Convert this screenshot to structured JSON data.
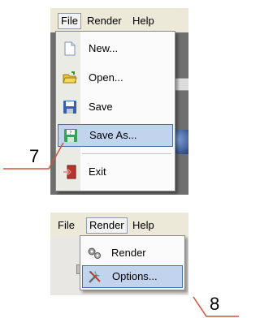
{
  "colors": {
    "callout": "#d0533a",
    "highlight_fill": "#c2d3ee",
    "highlight_border": "#4a6ea8"
  },
  "screenshot1": {
    "menubar": {
      "file": "File",
      "render": "Render",
      "help": "Help"
    },
    "file_menu": [
      {
        "label": "New...",
        "icon": "new-document-icon"
      },
      {
        "label": "Open...",
        "icon": "open-folder-icon"
      },
      {
        "label": "Save",
        "icon": "save-disk-icon"
      },
      {
        "label": "Save As...",
        "icon": "save-as-icon",
        "highlighted": true
      },
      {
        "label": "Exit",
        "icon": "exit-door-icon"
      }
    ],
    "background_tab": "e",
    "callout_number": "7"
  },
  "screenshot2": {
    "menubar": {
      "file": "File",
      "render": "Render",
      "help": "Help"
    },
    "render_menu": [
      {
        "label": "Render",
        "icon": "gears-icon"
      },
      {
        "label": "Options...",
        "icon": "tools-icon",
        "highlighted": true
      }
    ],
    "callout_number": "8"
  }
}
